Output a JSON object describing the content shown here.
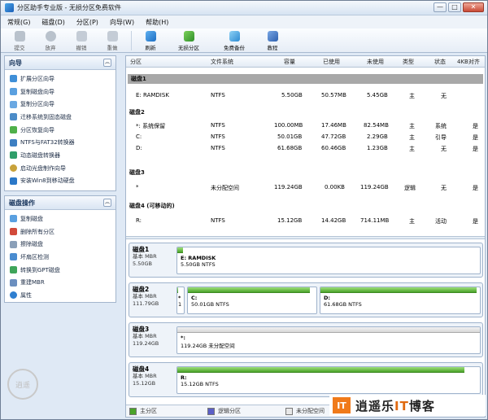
{
  "window": {
    "title": "分区助手专业版 - 无损分区免费软件",
    "buttons": [
      "—",
      "□",
      "✕"
    ]
  },
  "menu": [
    "常规(G)",
    "磁盘(D)",
    "分区(P)",
    "向导(W)",
    "帮助(H)"
  ],
  "toolbar": [
    {
      "label": "提交",
      "enabled": false,
      "icon": "check-icon"
    },
    {
      "label": "放弃",
      "enabled": false,
      "icon": "discard-icon"
    },
    {
      "label": "撤销",
      "enabled": false,
      "icon": "undo-icon"
    },
    {
      "label": "重做",
      "enabled": false,
      "icon": "redo-icon"
    },
    {
      "label": "刷新",
      "enabled": true,
      "icon": "refresh-icon"
    },
    {
      "label": "无损分区",
      "enabled": true,
      "icon": "partition-icon"
    },
    {
      "label": "免费备份",
      "enabled": true,
      "icon": "backup-icon"
    },
    {
      "label": "教程",
      "enabled": true,
      "icon": "tutorial-icon"
    }
  ],
  "wizard_panel": {
    "title": "向导",
    "items": [
      "扩展分区向导",
      "复制磁盘向导",
      "复制分区向导",
      "迁移系统到固态磁盘",
      "分区恢复向导",
      "NTFS与FAT32转换器",
      "动态磁盘转换器",
      "启动光盘制作向导",
      "安装Win8到移动硬盘"
    ]
  },
  "disk_panel": {
    "title": "磁盘操作",
    "items": [
      "复制磁盘",
      "删除所有分区",
      "擦除磁盘",
      "坏扇区检测",
      "转换到GPT磁盘",
      "重建MBR",
      "属性"
    ]
  },
  "table": {
    "headers": [
      "分区",
      "文件系统",
      "容量",
      "已使用",
      "未使用",
      "类型",
      "状态",
      "4KB对齐"
    ],
    "groups": [
      {
        "name": "磁盘1",
        "rows": [
          [
            "E: RAMDISK",
            "NTFS",
            "5.50GB",
            "50.57MB",
            "5.45GB",
            "主",
            "无",
            ""
          ]
        ]
      },
      {
        "name": "磁盘2",
        "rows": [
          [
            "*: 系统保留",
            "NTFS",
            "100.00MB",
            "17.46MB",
            "82.54MB",
            "主",
            "系统",
            "是"
          ],
          [
            "C:",
            "NTFS",
            "50.01GB",
            "47.72GB",
            "2.29GB",
            "主",
            "引导",
            "是"
          ],
          [
            "D:",
            "NTFS",
            "61.68GB",
            "60.46GB",
            "1.23GB",
            "主",
            "无",
            "是"
          ]
        ]
      },
      {
        "name": "磁盘3",
        "rows": [
          [
            "*",
            "未分配空间",
            "119.24GB",
            "0.00KB",
            "119.24GB",
            "逻辑",
            "无",
            "是"
          ]
        ]
      },
      {
        "name": "磁盘4 (可移动的)",
        "rows": [
          [
            "R:",
            "NTFS",
            "15.12GB",
            "14.42GB",
            "714.11MB",
            "主",
            "活动",
            "是"
          ]
        ]
      }
    ]
  },
  "disk_map": [
    {
      "name": "磁盘1",
      "type": "基本 MBR",
      "size": "5.50GB",
      "parts": [
        {
          "label": "E: RAMDISK",
          "sub": "5.50GB NTFS",
          "used": 0.01
        }
      ]
    },
    {
      "name": "磁盘2",
      "type": "基本 MBR",
      "size": "111.79GB",
      "parts": [
        {
          "label": "*",
          "sub": "1",
          "used": 0.17
        },
        {
          "label": "C:",
          "sub": "50.01GB NTFS",
          "used": 0.95
        },
        {
          "label": "D:",
          "sub": "61.68GB NTFS",
          "used": 0.98
        }
      ]
    },
    {
      "name": "磁盘3",
      "type": "基本 MBR",
      "size": "119.24GB",
      "parts": [
        {
          "label": "*:",
          "sub": "119.24GB 未分配空间",
          "used": 0
        }
      ]
    },
    {
      "name": "磁盘4",
      "type": "基本 MBR",
      "size": "15.12GB",
      "parts": [
        {
          "label": "R:",
          "sub": "15.12GB NTFS",
          "used": 0.95
        }
      ]
    }
  ],
  "legend": [
    "主分区",
    "逻辑分区",
    "未分配空间"
  ],
  "watermark": {
    "box": "IT",
    "text_a": "逍遥乐",
    "text_it": "IT",
    "text_b": "博客"
  },
  "seal": "逍遥",
  "colors": {
    "primary": "#4aa32a",
    "logical": "#5b5fc7",
    "unallocated": "#e8e8e8",
    "accent": "#f07a1a"
  }
}
